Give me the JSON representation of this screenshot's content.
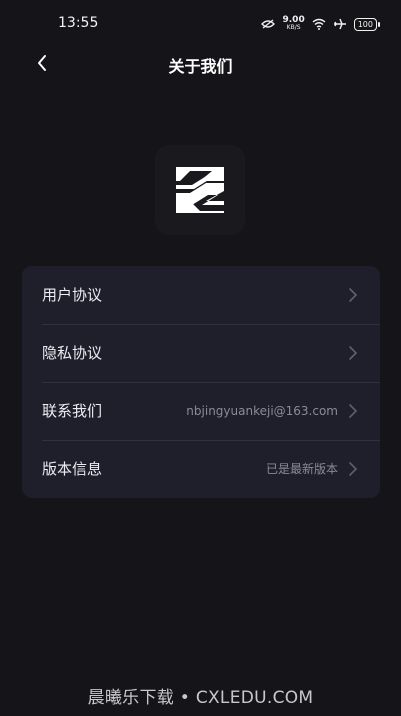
{
  "status_bar": {
    "time": "13:55",
    "network_speed_value": "9.00",
    "network_speed_unit": "KB/S",
    "battery": "100",
    "icons": [
      "mute-icon",
      "wifi-icon",
      "airplane-icon",
      "battery-icon"
    ]
  },
  "header": {
    "title": "关于我们",
    "back_icon": "chevron-left-icon"
  },
  "logo": {
    "icon": "app-logo-icon"
  },
  "menu": {
    "items": [
      {
        "label": "用户协议",
        "value": ""
      },
      {
        "label": "隐私协议",
        "value": ""
      },
      {
        "label": "联系我们",
        "value": "nbjingyuankeji@163.com"
      },
      {
        "label": "版本信息",
        "value": "已是最新版本"
      }
    ]
  },
  "watermark": "晨曦乐下载 • CXLEDU.COM",
  "colors": {
    "background": "#151519",
    "card": "#1e1f2b",
    "divider": "#30313e",
    "secondary_text": "#8a8b96"
  }
}
